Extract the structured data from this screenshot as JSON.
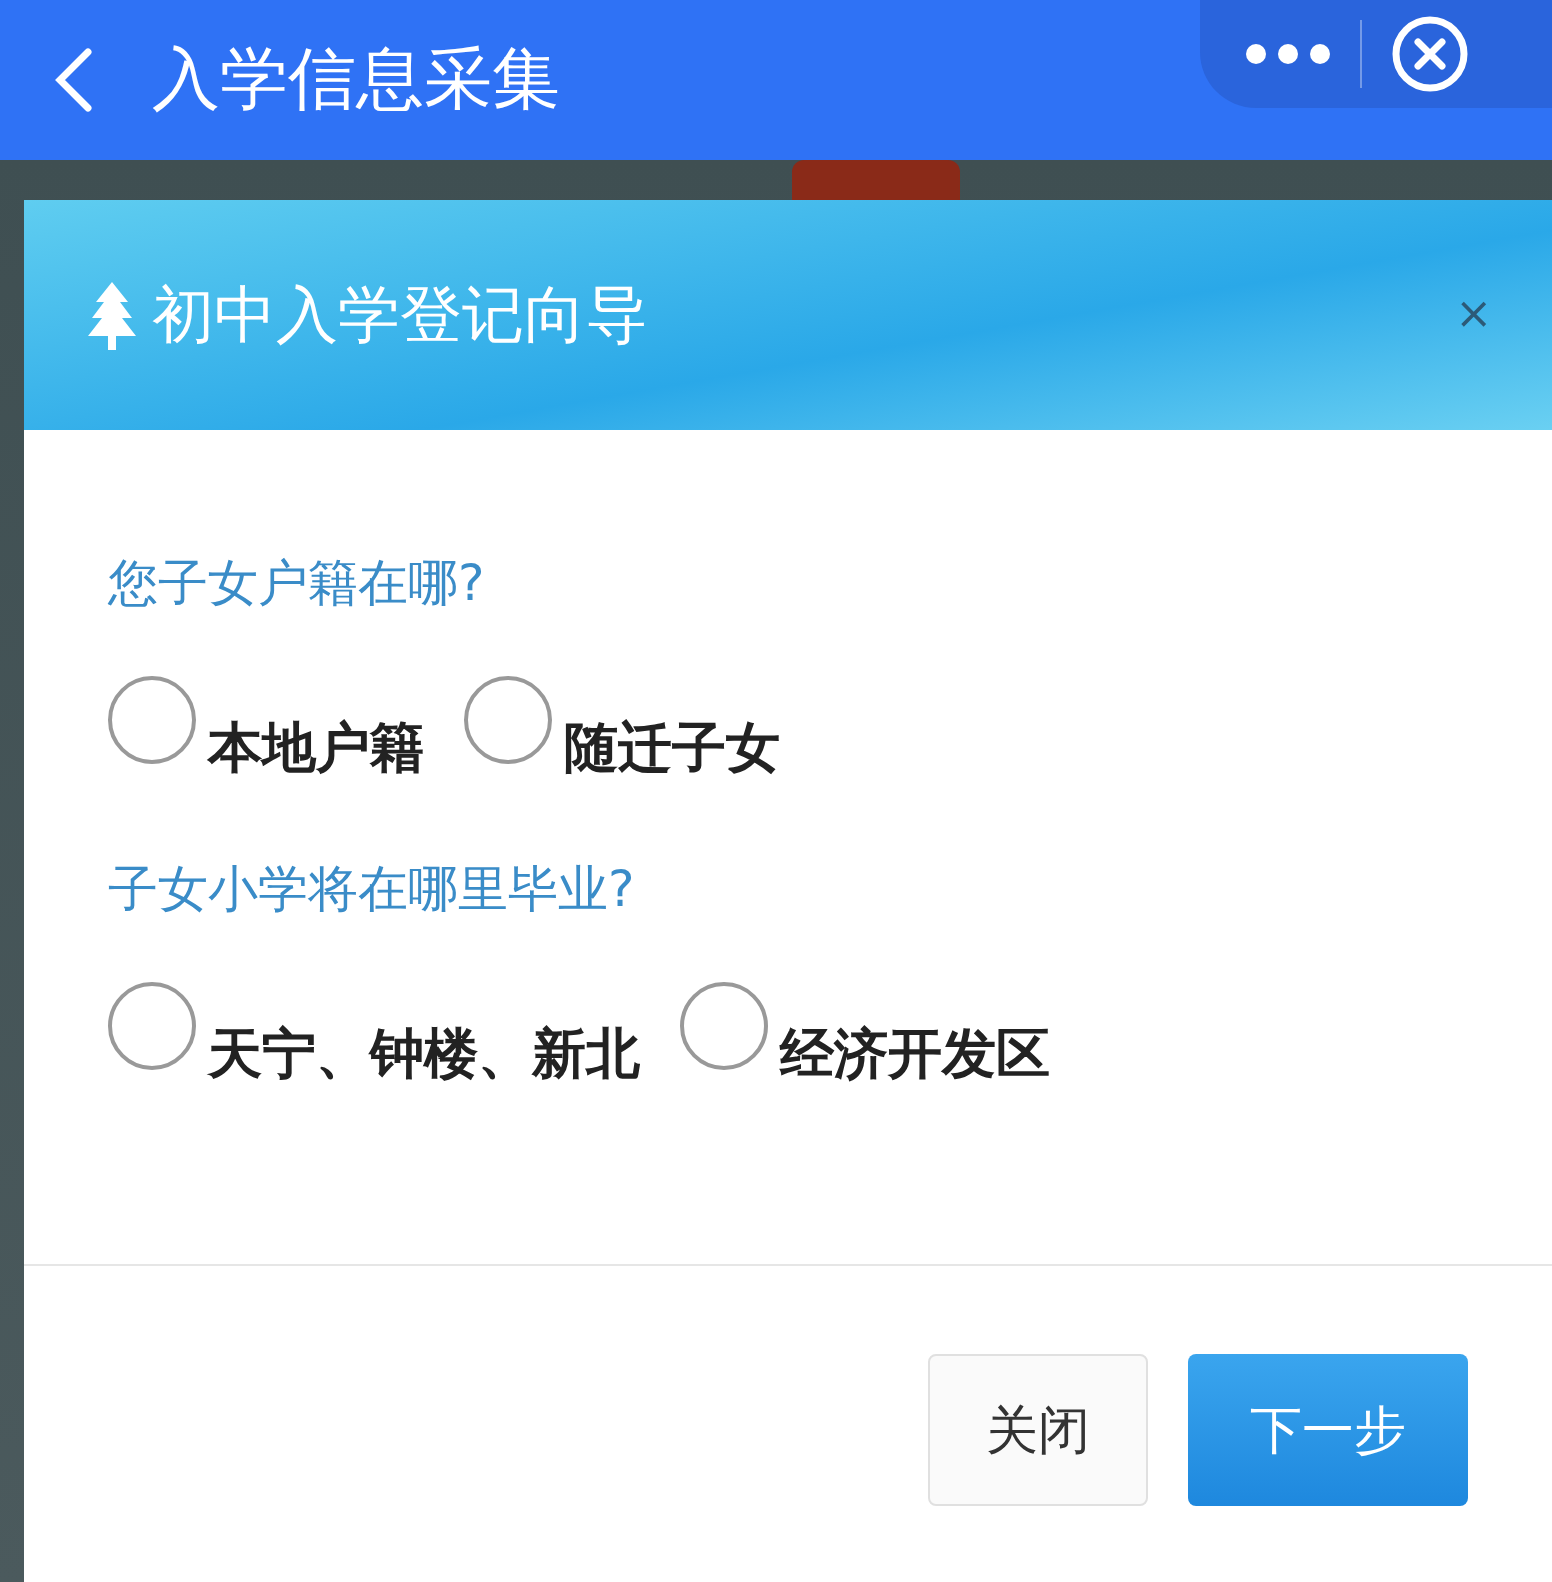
{
  "top_bar": {
    "title": "入学信息采集"
  },
  "dialog": {
    "title": "初中入学登记向导",
    "close": "×",
    "questions": [
      {
        "label": "您子女户籍在哪?",
        "options": [
          {
            "label": "本地户籍",
            "selected": false
          },
          {
            "label": "随迁子女",
            "selected": false
          }
        ]
      },
      {
        "label": "子女小学将在哪里毕业?",
        "options": [
          {
            "label": "天宁、钟楼、新北",
            "selected": false
          },
          {
            "label": "经济开发区",
            "selected": false
          }
        ]
      }
    ],
    "buttons": [
      {
        "label": "关闭",
        "kind": "secondary"
      },
      {
        "label": "下一步",
        "kind": "primary"
      }
    ]
  }
}
